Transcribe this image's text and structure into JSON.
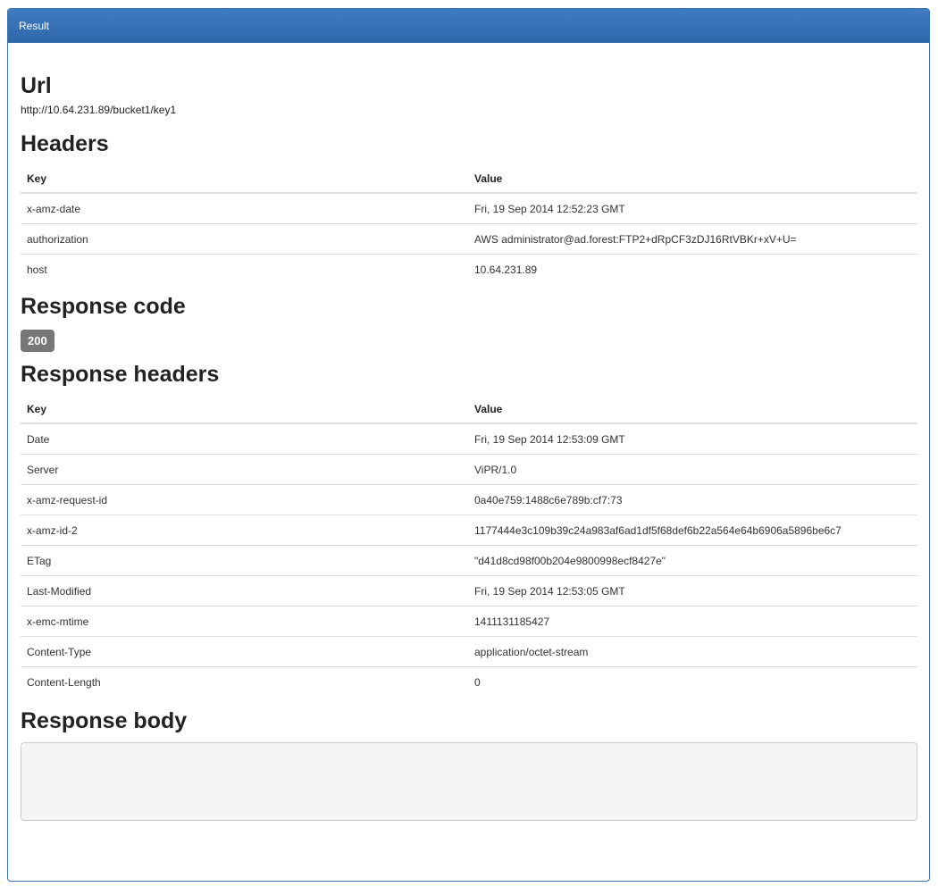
{
  "panel": {
    "title": "Result"
  },
  "url": {
    "heading": "Url",
    "value": "http://10.64.231.89/bucket1/key1"
  },
  "headers": {
    "heading": "Headers",
    "columns": {
      "key": "Key",
      "value": "Value"
    },
    "rows": [
      {
        "key": "x-amz-date",
        "value": "Fri, 19 Sep 2014 12:52:23 GMT"
      },
      {
        "key": "authorization",
        "value": "AWS administrator@ad.forest:FTP2+dRpCF3zDJ16RtVBKr+xV+U="
      },
      {
        "key": "host",
        "value": "10.64.231.89"
      }
    ]
  },
  "response_code": {
    "heading": "Response code",
    "value": "200",
    "badge_color": "#777777"
  },
  "response_headers": {
    "heading": "Response headers",
    "columns": {
      "key": "Key",
      "value": "Value"
    },
    "rows": [
      {
        "key": "Date",
        "value": "Fri, 19 Sep 2014 12:53:09 GMT"
      },
      {
        "key": "Server",
        "value": "ViPR/1.0"
      },
      {
        "key": "x-amz-request-id",
        "value": "0a40e759:1488c6e789b:cf7:73"
      },
      {
        "key": "x-amz-id-2",
        "value": "1177444e3c109b39c24a983af6ad1df5f68def6b22a564e64b6906a5896be6c7"
      },
      {
        "key": "ETag",
        "value": "\"d41d8cd98f00b204e9800998ecf8427e\""
      },
      {
        "key": "Last-Modified",
        "value": "Fri, 19 Sep 2014 12:53:05 GMT"
      },
      {
        "key": "x-emc-mtime",
        "value": "1411131185427"
      },
      {
        "key": "Content-Type",
        "value": "application/octet-stream"
      },
      {
        "key": "Content-Length",
        "value": "0"
      }
    ]
  },
  "response_body": {
    "heading": "Response body",
    "value": ""
  },
  "colors": {
    "panel_header": "#337ab7",
    "badge": "#777777"
  }
}
